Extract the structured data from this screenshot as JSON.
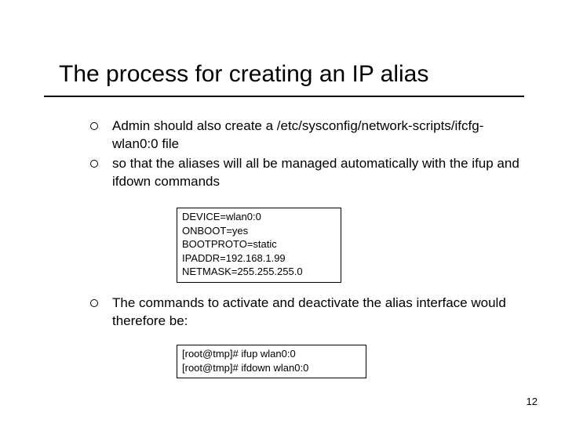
{
  "title": "The process for creating an IP alias",
  "bullets_top": [
    "Admin should also create a /etc/sysconfig/network-scripts/ifcfg-wlan0:0 file",
    "so that the aliases will all be managed automatically with the ifup and ifdown commands"
  ],
  "code_box1": "DEVICE=wlan0:0\nONBOOT=yes\nBOOTPROTO=static\nIPADDR=192.168.1.99\nNETMASK=255.255.255.0",
  "bullets_bottom": [
    "The commands to activate and deactivate the alias interface would therefore be:"
  ],
  "code_box2": "[root@tmp]# ifup wlan0:0\n[root@tmp]# ifdown wlan0:0",
  "page_number": "12"
}
